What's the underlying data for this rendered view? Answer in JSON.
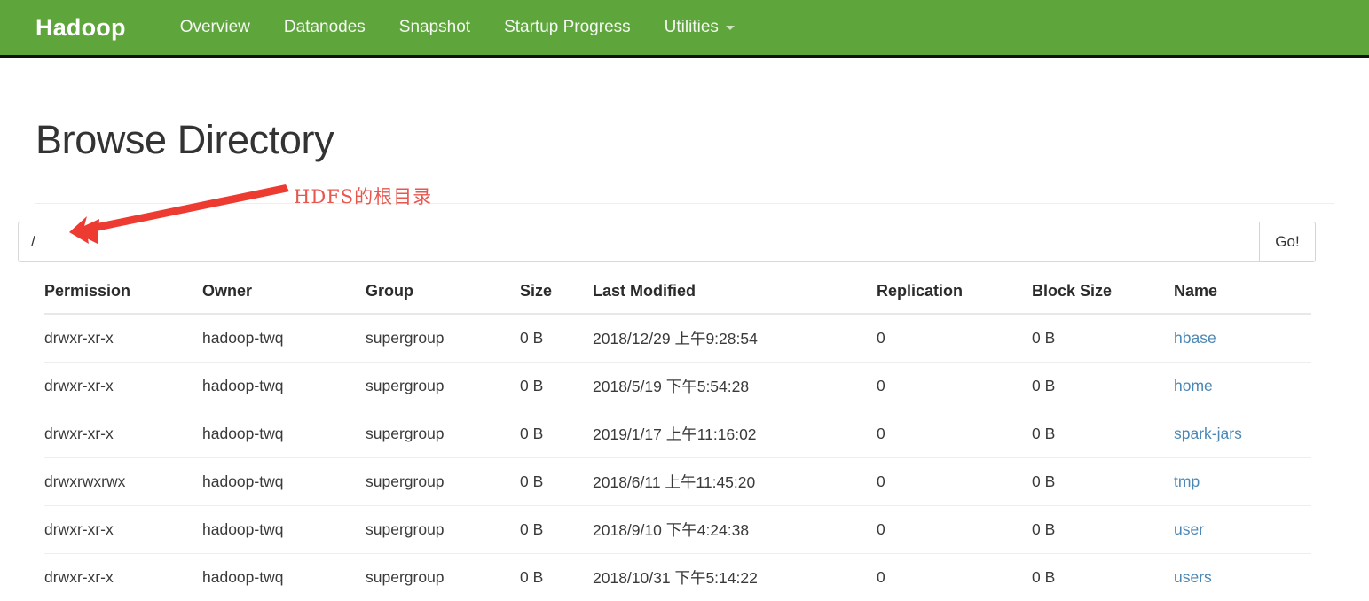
{
  "navbar": {
    "brand": "Hadoop",
    "items": [
      {
        "label": "Overview",
        "icon": null
      },
      {
        "label": "Datanodes",
        "icon": null
      },
      {
        "label": "Snapshot",
        "icon": null
      },
      {
        "label": "Startup Progress",
        "icon": null
      },
      {
        "label": "Utilities",
        "icon": "chevron-down-icon"
      }
    ],
    "background_color": "#5ea63c",
    "text_color": "#ffffff"
  },
  "page": {
    "title": "Browse Directory"
  },
  "path_form": {
    "value": "/",
    "placeholder": "",
    "go_label": "Go!"
  },
  "annotation": {
    "text": "HDFS的根目录",
    "color": "#e8564e"
  },
  "table": {
    "headers": [
      "Permission",
      "Owner",
      "Group",
      "Size",
      "Last Modified",
      "Replication",
      "Block Size",
      "Name"
    ],
    "rows": [
      {
        "permission": "drwxr-xr-x",
        "owner": "hadoop-twq",
        "group": "supergroup",
        "size": "0 B",
        "last_modified": "2018/12/29 上午9:28:54",
        "replication": "0",
        "block_size": "0 B",
        "name": "hbase"
      },
      {
        "permission": "drwxr-xr-x",
        "owner": "hadoop-twq",
        "group": "supergroup",
        "size": "0 B",
        "last_modified": "2018/5/19 下午5:54:28",
        "replication": "0",
        "block_size": "0 B",
        "name": "home"
      },
      {
        "permission": "drwxr-xr-x",
        "owner": "hadoop-twq",
        "group": "supergroup",
        "size": "0 B",
        "last_modified": "2019/1/17 上午11:16:02",
        "replication": "0",
        "block_size": "0 B",
        "name": "spark-jars"
      },
      {
        "permission": "drwxrwxrwx",
        "owner": "hadoop-twq",
        "group": "supergroup",
        "size": "0 B",
        "last_modified": "2018/6/11 上午11:45:20",
        "replication": "0",
        "block_size": "0 B",
        "name": "tmp"
      },
      {
        "permission": "drwxr-xr-x",
        "owner": "hadoop-twq",
        "group": "supergroup",
        "size": "0 B",
        "last_modified": "2018/9/10 下午4:24:38",
        "replication": "0",
        "block_size": "0 B",
        "name": "user"
      },
      {
        "permission": "drwxr-xr-x",
        "owner": "hadoop-twq",
        "group": "supergroup",
        "size": "0 B",
        "last_modified": "2018/10/31 下午5:14:22",
        "replication": "0",
        "block_size": "0 B",
        "name": "users"
      }
    ]
  }
}
